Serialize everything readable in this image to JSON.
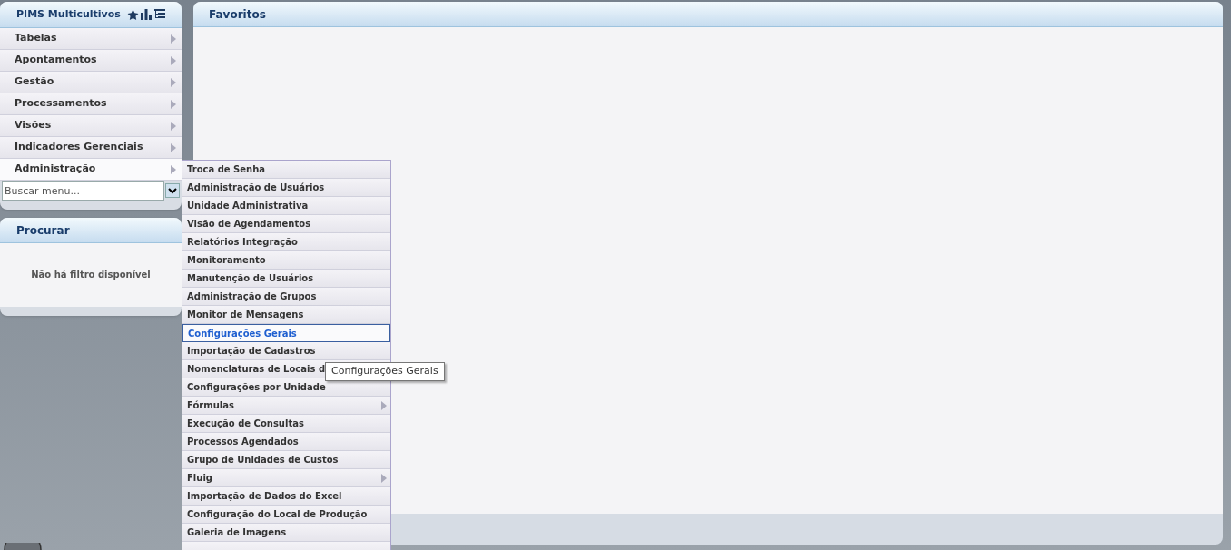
{
  "sidebar": {
    "title": "PIMS Multicultivos",
    "menu": [
      {
        "label": "Tabelas",
        "has_children": true,
        "selected": false
      },
      {
        "label": "Apontamentos",
        "has_children": true,
        "selected": false
      },
      {
        "label": "Gestão",
        "has_children": true,
        "selected": false
      },
      {
        "label": "Processamentos",
        "has_children": true,
        "selected": false
      },
      {
        "label": "Visões",
        "has_children": true,
        "selected": false
      },
      {
        "label": "Indicadores Gerenciais",
        "has_children": true,
        "selected": false
      },
      {
        "label": "Administração",
        "has_children": true,
        "selected": true
      }
    ],
    "search": {
      "placeholder": "Buscar menu..."
    }
  },
  "search_panel": {
    "title": "Procurar",
    "empty_message": "Não há filtro disponível"
  },
  "favorites": {
    "title": "Favoritos"
  },
  "submenu": [
    {
      "label": "Troca de Senha",
      "has_children": false,
      "selected": false
    },
    {
      "label": "Administração de Usuários",
      "has_children": false,
      "selected": false
    },
    {
      "label": "Unidade Administrativa",
      "has_children": false,
      "selected": false
    },
    {
      "label": "Visão de Agendamentos",
      "has_children": false,
      "selected": false
    },
    {
      "label": "Relatórios Integração",
      "has_children": false,
      "selected": false
    },
    {
      "label": "Monitoramento",
      "has_children": false,
      "selected": false
    },
    {
      "label": "Manutenção de Usuários",
      "has_children": false,
      "selected": false
    },
    {
      "label": "Administração de Grupos",
      "has_children": false,
      "selected": false
    },
    {
      "label": "Monitor de Mensagens",
      "has_children": false,
      "selected": false
    },
    {
      "label": "Configurações Gerais",
      "has_children": false,
      "selected": true
    },
    {
      "label": "Importação de Cadastros",
      "has_children": false,
      "selected": false
    },
    {
      "label": "Nomenclaturas de Locais d",
      "selected": false
    },
    {
      "label": "Configurações por Unidade",
      "has_children": false,
      "selected": false
    },
    {
      "label": "Fórmulas",
      "has_children": true,
      "selected": false
    },
    {
      "label": "Execução de Consultas",
      "has_children": false,
      "selected": false
    },
    {
      "label": "Processos Agendados",
      "has_children": false,
      "selected": false
    },
    {
      "label": "Grupo de Unidades de Custos",
      "has_children": false,
      "selected": false
    },
    {
      "label": "Fluig",
      "has_children": true,
      "selected": false
    },
    {
      "label": "Importação de Dados do Excel",
      "has_children": false,
      "selected": false
    },
    {
      "label": "Configuração do Local de Produção",
      "has_children": false,
      "selected": false
    },
    {
      "label": "Galeria de Imagens",
      "has_children": false,
      "selected": false
    }
  ],
  "tooltip": "Configurações Gerais"
}
